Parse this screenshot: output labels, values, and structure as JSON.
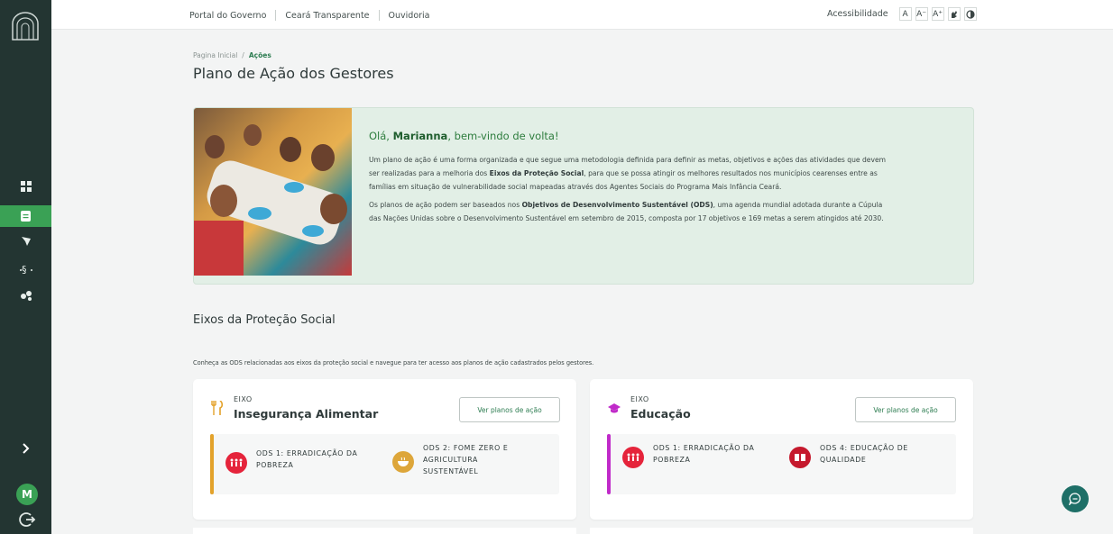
{
  "sidebar": {
    "items": [
      {
        "name": "dashboard-icon",
        "active": false
      },
      {
        "name": "document-icon",
        "active": true
      },
      {
        "name": "map-pin-icon",
        "active": false
      },
      {
        "name": "ods-icon",
        "active": false
      },
      {
        "name": "people-icon",
        "active": false
      }
    ],
    "expand_icon": "chevron-right-icon",
    "avatar_initial": "M",
    "logout_icon": "logout-icon"
  },
  "topbar": {
    "links": [
      "Portal do Governo",
      "Ceará Transparente",
      "Ouvidoria"
    ],
    "accessibility_label": "Acessibilidade",
    "acc_buttons": [
      "A",
      "A⁻",
      "A⁺"
    ]
  },
  "breadcrumb": {
    "home": "Pagina Inicial",
    "separator": "/",
    "current": "Ações"
  },
  "page_title": "Plano de Ação dos Gestores",
  "welcome": {
    "greeting_prefix": "Olá, ",
    "user_name": "Marianna",
    "greeting_suffix": ", bem-vindo de volta!",
    "para1_a": "Um plano de ação é uma forma organizada e que segue uma metodologia definida para definir as metas, objetivos e ações das atividades que devem ser realizadas para a melhoria dos ",
    "para1_bold": "Eixos da Proteção Social",
    "para1_b": ", para que se possa atingir os melhores resultados nos municípios cearenses entre as famílias em situação de vulnerabilidade social mapeadas através dos Agentes Sociais do Programa Mais Infância Ceará.",
    "para2_a": "Os planos de ação podem ser baseados nos ",
    "para2_bold": "Objetivos de Desenvolvimento Sustentável (ODS)",
    "para2_b": ", uma agenda mundial adotada durante a Cúpula das Nações Unidas sobre o Desenvolvimento Sustentável em setembro de 2015, composta por 17 objetivos e 169 metas a serem atingidos até 2030."
  },
  "section": {
    "title": "Eixos da Proteção Social",
    "description": "Conheça as ODS relacionadas aos eixos da proteção social e navegue para ter acesso aos planos de ação cadastrados pelos gestores."
  },
  "eixos": [
    {
      "small": "EIXO",
      "name": "Insegurança Alimentar",
      "icon": "utensils-icon",
      "icon_color": "#e3a22b",
      "bar_color": "#e3a22b",
      "button": "Ver planos de ação",
      "ods": [
        {
          "line1": "ODS 1: ERRADICAÇÃO DA",
          "line2": "POBREZA",
          "line3": "",
          "color": "#e5243b",
          "icon": "family-icon"
        },
        {
          "line1": "ODS 2: FOME ZERO E",
          "line2": "AGRICULTURA",
          "line3": "SUSTENTÁVEL",
          "color": "#dda63a",
          "icon": "bowl-icon"
        }
      ]
    },
    {
      "small": "EIXO",
      "name": "Educação",
      "icon": "graduation-cap-icon",
      "icon_color": "#c02ac9",
      "bar_color": "#c02ac9",
      "button": "Ver planos de ação",
      "ods": [
        {
          "line1": "ODS 1: ERRADICAÇÃO DA",
          "line2": "POBREZA",
          "line3": "",
          "color": "#e5243b",
          "icon": "family-icon"
        },
        {
          "line1": "ODS 4: EDUCAÇÃO DE",
          "line2": "QUALIDADE",
          "line3": "",
          "color": "#c5192d",
          "icon": "book-icon"
        }
      ]
    }
  ],
  "chat_icon": "chat-icon"
}
